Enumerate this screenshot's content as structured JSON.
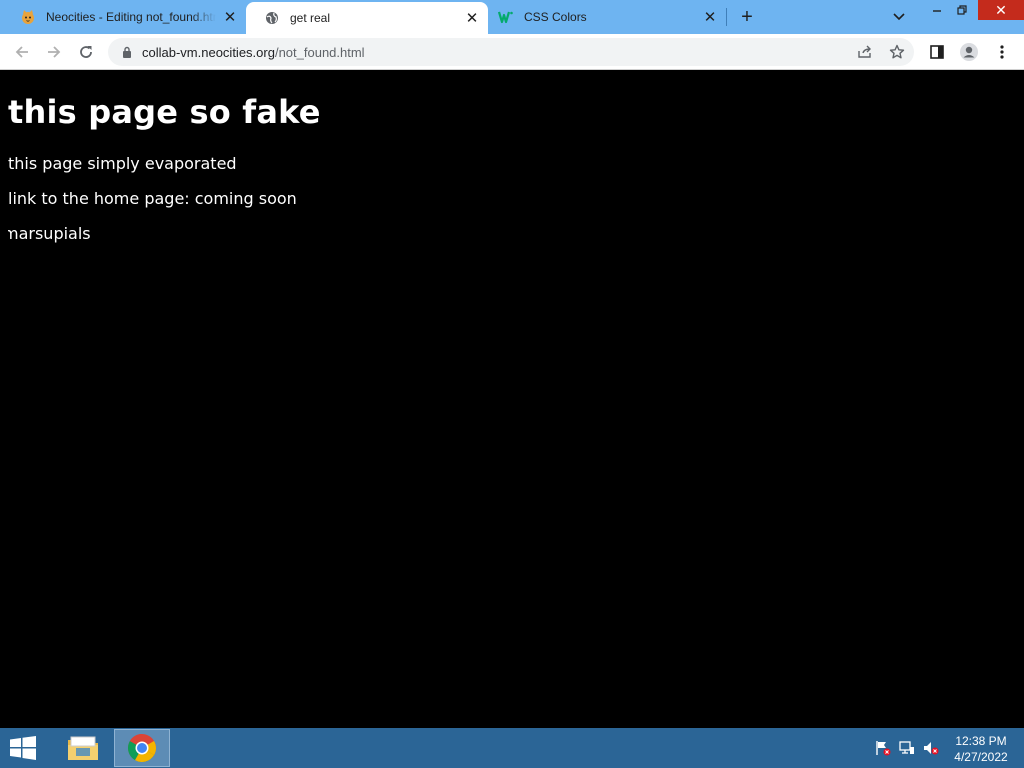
{
  "browser": {
    "tabs": [
      {
        "title": "Neocities - Editing not_found.html",
        "icon": "neocities-cat-icon",
        "active": false
      },
      {
        "title": "get real",
        "icon": "globe-icon",
        "active": true
      },
      {
        "title": "CSS Colors",
        "icon": "w3schools-icon",
        "active": false
      }
    ],
    "url_host": "collab-vm.neocities.org",
    "url_path": "/not_found.html"
  },
  "page": {
    "heading": "this page so fake",
    "line1": "this page simply evaporated",
    "line2": "link to the home page: coming soon",
    "marquee": "marsupials"
  },
  "taskbar": {
    "time": "12:38 PM",
    "date": "4/27/2022"
  },
  "colors": {
    "tabstrip": "#6eb4f1",
    "page_bg": "#000000",
    "page_text": "#ffffff",
    "taskbar": "#2b6596"
  }
}
